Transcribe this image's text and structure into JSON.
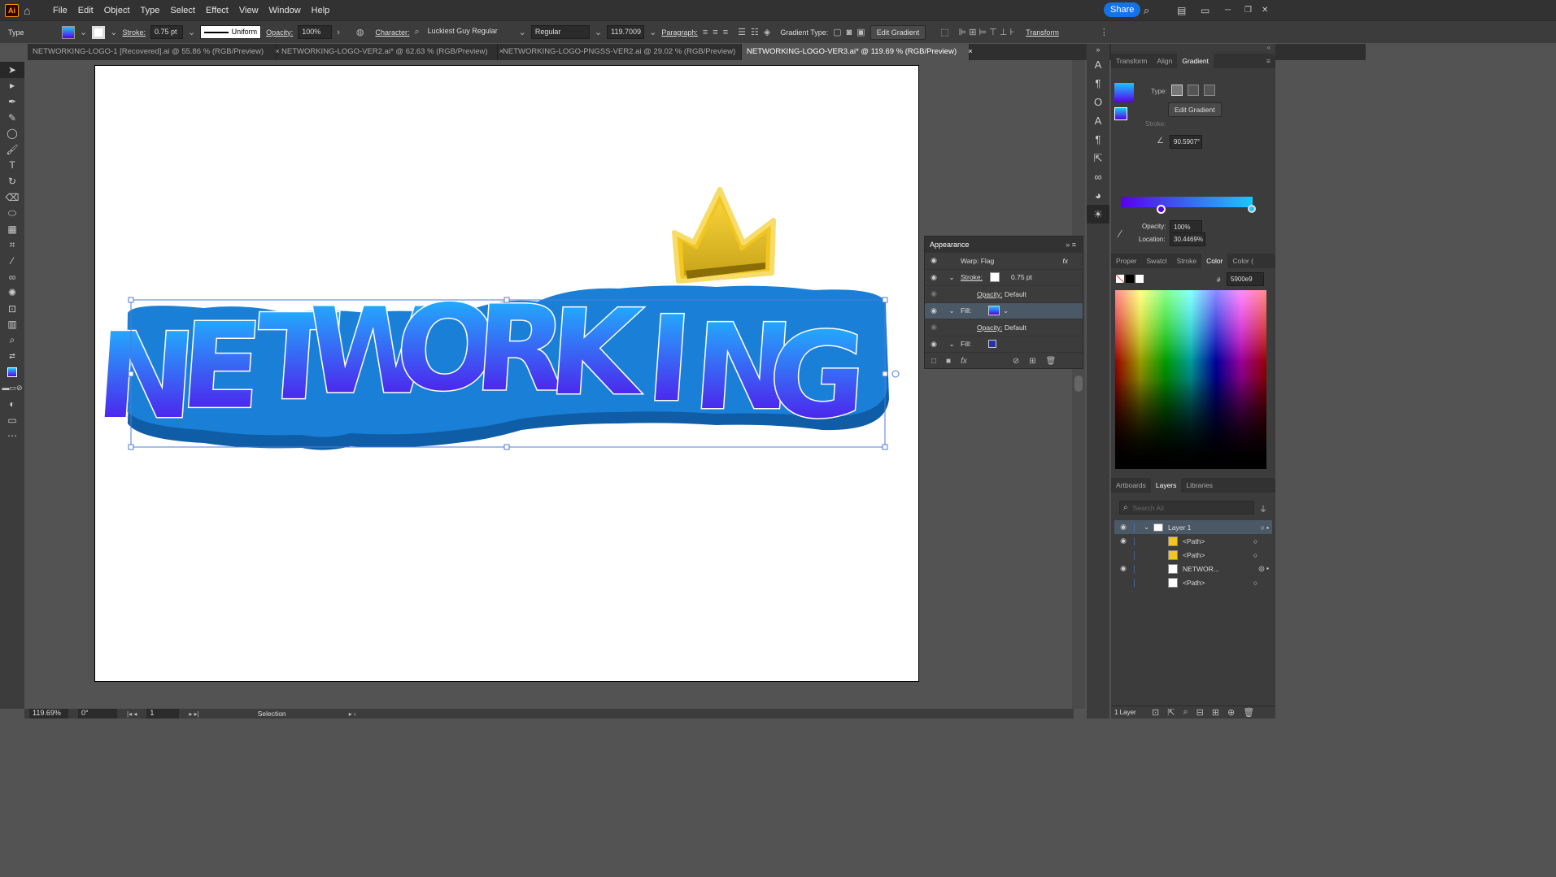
{
  "app": {
    "logo": "Ai",
    "share_label": "Share"
  },
  "menu": [
    "File",
    "Edit",
    "Object",
    "Type",
    "Select",
    "Effect",
    "View",
    "Window",
    "Help"
  ],
  "control": {
    "mode": "Type",
    "stroke_label": "Stroke:",
    "stroke_value": "0.75 pt",
    "stroke_profile": "Uniform",
    "opacity_label": "Opacity:",
    "opacity_value": "100%",
    "character_label": "Character:",
    "font_family": "Luckiest Guy Regular",
    "font_style": "Regular",
    "font_size": "119.7009",
    "paragraph_label": "Paragraph:",
    "gradient_type_label": "Gradient Type:",
    "edit_gradient": "Edit Gradient",
    "transform": "Transform"
  },
  "tabs": [
    {
      "label": "NETWORKING-LOGO-1 [Recovered].ai @ 55.86 % (RGB/Preview)",
      "close": "×"
    },
    {
      "label": "NETWORKING-LOGO-VER2.ai* @ 62.63 % (RGB/Preview)",
      "close": "×"
    },
    {
      "label": "NETWORKING-LOGO-PNGSS-VER2.ai @ 29.02 % (RGB/Preview)",
      "close": "×"
    },
    {
      "label": "NETWORKING-LOGO-VER3.ai* @ 119.69 % (RGB/Preview)",
      "close": "×"
    }
  ],
  "artwork": {
    "text": "NETWORKING"
  },
  "appearance": {
    "title": "Appearance",
    "rows": [
      {
        "label": "Warp: Flag",
        "value": "",
        "fx": "fx"
      },
      {
        "label": "Stroke:",
        "value": "0.75 pt"
      },
      {
        "label": "Opacity:",
        "value": "Default"
      },
      {
        "label": "Fill:",
        "value": ""
      },
      {
        "label": "Opacity:",
        "value": "Default"
      },
      {
        "label": "Fill:",
        "value": ""
      }
    ]
  },
  "gradient_panel": {
    "tabs": [
      "Transform",
      "Align",
      "Gradient"
    ],
    "type_label": "Type:",
    "edit_gradient": "Edit Gradient",
    "stroke_label": "Stroke:",
    "angle": "90.5907°",
    "opacity_label": "Opacity:",
    "opacity": "100%",
    "location_label": "Location:",
    "location": "30.4469%"
  },
  "color_panel": {
    "tabs": [
      "Proper",
      "Swatcl",
      "Stroke",
      "Color",
      "Color ("
    ],
    "hex_prefix": "#",
    "hex": "5900e9"
  },
  "layers_panel": {
    "tabs": [
      "Artboards",
      "Layers",
      "Libraries"
    ],
    "search_placeholder": "Search All",
    "layer": "Layer 1",
    "items": [
      "<Path>",
      "<Path>",
      "NETWOR...",
      "<Path>"
    ],
    "footer": "1 Layer"
  },
  "status": {
    "zoom": "119.69%",
    "rotation": "0°",
    "artboard": "1",
    "tool": "Selection"
  },
  "colors": {
    "grad_start": "#5900e9",
    "grad_end": "#19c8ff",
    "outline": "#1a7fd6",
    "crown": "#f2c61f"
  }
}
